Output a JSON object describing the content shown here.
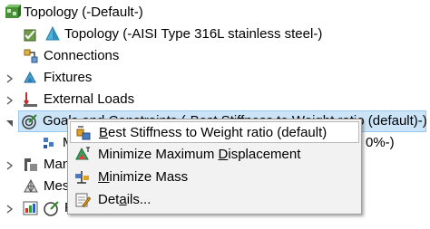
{
  "tree": {
    "root_label": "Topology (-Default-)",
    "part_label": "Topology (-AISI Type 316L stainless steel-)",
    "connections_label": "Connections",
    "fixtures_label": "Fixtures",
    "external_loads_label": "External Loads",
    "goals_label": "Goals and Constraints (-Best Stiffness to Weight ratio (default)-)",
    "goal_child_prefix": "M",
    "goal_child_suffix": "0%-)",
    "manufacturing_prefix": "Man",
    "mesh_prefix": "Mes",
    "results_prefix": "R"
  },
  "context_menu": {
    "items": [
      {
        "pre": "",
        "mn": "B",
        "post": "est Stiffness to Weight ratio (default)"
      },
      {
        "pre": "Minimize Maximum ",
        "mn": "D",
        "post": "isplacement"
      },
      {
        "pre": "",
        "mn": "M",
        "post": "inimize Mass"
      },
      {
        "pre": "Det",
        "mn": "a",
        "post": "ils..."
      }
    ]
  },
  "colors": {
    "selection_bg": "#cce4f7",
    "selection_border": "#99c9ef",
    "menu_bg": "#f2f2f2"
  }
}
